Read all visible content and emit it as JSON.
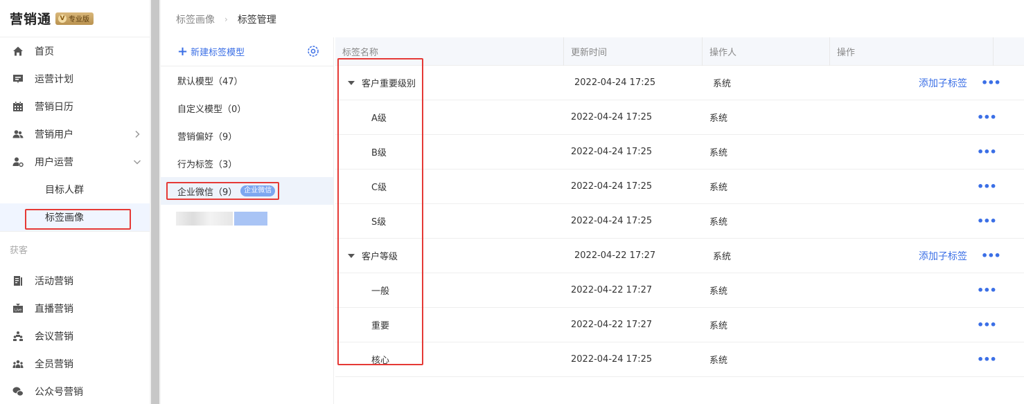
{
  "brand": {
    "name": "营销通",
    "badge": "专业版",
    "badge_icon": "V"
  },
  "sidebar": {
    "items": [
      {
        "label": "首页",
        "icon": "home-icon"
      },
      {
        "label": "运营计划",
        "icon": "plan-icon"
      },
      {
        "label": "营销日历",
        "icon": "calendar-icon"
      },
      {
        "label": "营销用户",
        "icon": "users-icon"
      },
      {
        "label": "用户运营",
        "icon": "user-settings-icon"
      }
    ],
    "sub_items": [
      {
        "label": "目标人群"
      },
      {
        "label": "标签画像"
      }
    ],
    "section": "获客",
    "section_items": [
      {
        "label": "活动营销",
        "icon": "document-icon"
      },
      {
        "label": "直播营销",
        "icon": "live-icon"
      },
      {
        "label": "会议营销",
        "icon": "meeting-icon"
      },
      {
        "label": "全员营销",
        "icon": "team-icon"
      },
      {
        "label": "公众号营销",
        "icon": "wechat-icon"
      }
    ]
  },
  "breadcrumb": {
    "prev": "标签画像",
    "current": "标签管理"
  },
  "models": {
    "new_label": "新建标签模型",
    "items": [
      {
        "label": "默认模型（47）"
      },
      {
        "label": "自定义模型（0）"
      },
      {
        "label": "营销偏好（9）"
      },
      {
        "label": "行为标签（3）"
      },
      {
        "label": "企业微信（9）",
        "tag": "企业微信"
      }
    ]
  },
  "table": {
    "headers": [
      "标签名称",
      "更新时间",
      "操作人",
      "操作"
    ],
    "add_sub_label": "添加子标签",
    "more_label": "•••",
    "rows": [
      {
        "name": "客户重要级别",
        "time": "2022-04-24 17:25",
        "operator": "系统",
        "parent": true
      },
      {
        "name": "A级",
        "time": "2022-04-24 17:25",
        "operator": "系统",
        "parent": false
      },
      {
        "name": "B级",
        "time": "2022-04-24 17:25",
        "operator": "系统",
        "parent": false
      },
      {
        "name": "C级",
        "time": "2022-04-24 17:25",
        "operator": "系统",
        "parent": false
      },
      {
        "name": "S级",
        "time": "2022-04-24 17:25",
        "operator": "系统",
        "parent": false
      },
      {
        "name": "客户等级",
        "time": "2022-04-22 17:27",
        "operator": "系统",
        "parent": true
      },
      {
        "name": "一般",
        "time": "2022-04-22 17:27",
        "operator": "系统",
        "parent": false
      },
      {
        "name": "重要",
        "time": "2022-04-22 17:27",
        "operator": "系统",
        "parent": false
      },
      {
        "name": "核心",
        "time": "2022-04-24 17:25",
        "operator": "系统",
        "parent": false
      }
    ]
  },
  "colors": {
    "accent": "#3b6fe6",
    "highlight": "#e53935",
    "tag_bg": "#7da7f0"
  }
}
